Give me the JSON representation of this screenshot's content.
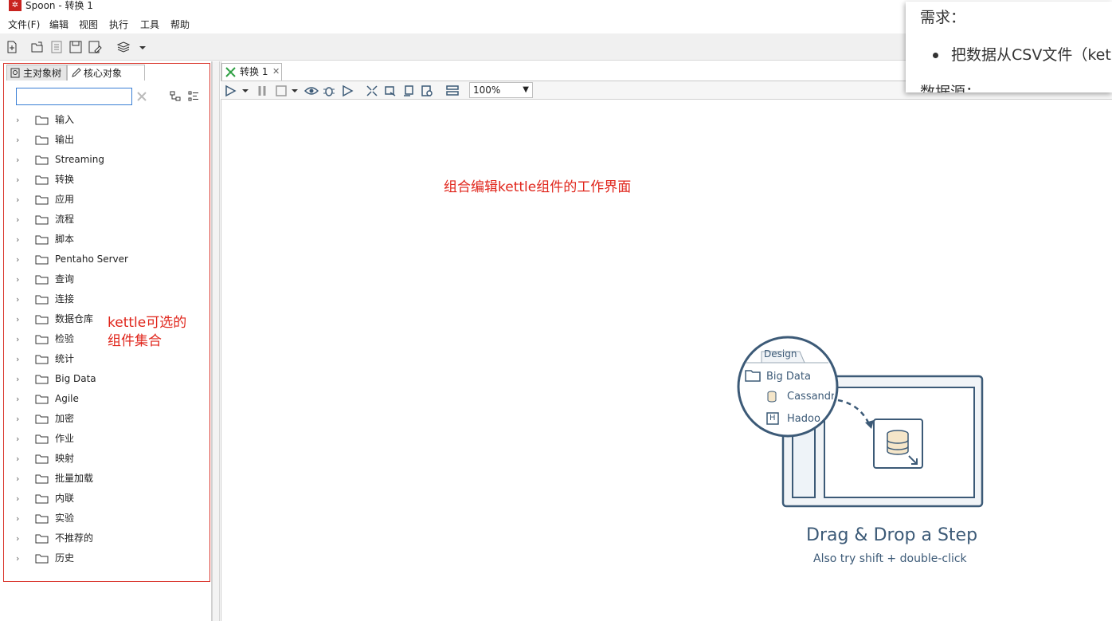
{
  "window": {
    "title": "Spoon - 转换 1"
  },
  "menu": {
    "items": [
      "文件(F)",
      "编辑",
      "视图",
      "执行",
      "工具",
      "帮助"
    ]
  },
  "left_panel": {
    "tabs": [
      "主对象树",
      "核心对象"
    ],
    "search_value": "",
    "tree": [
      "输入",
      "输出",
      "Streaming",
      "转换",
      "应用",
      "流程",
      "脚本",
      "Pentaho Server",
      "查询",
      "连接",
      "数据仓库",
      "检验",
      "统计",
      "Big Data",
      "Agile",
      "加密",
      "作业",
      "映射",
      "批量加载",
      "内联",
      "实验",
      "不推荐的",
      "历史"
    ]
  },
  "annotations": {
    "left_line1": "kettle可选的",
    "left_line2": "组件集合",
    "canvas": "组合编辑kettle组件的工作界面"
  },
  "canvas": {
    "tab_label": "转换 1",
    "zoom": "100%"
  },
  "note_panel": {
    "heading": "需求：",
    "bullet": "把数据从CSV文件（ket",
    "heading2": "数据源："
  },
  "illustration": {
    "design_tab": "Design",
    "folder": "Big Data",
    "item1": "Cassandr",
    "item2": "Hadoo",
    "title": "Drag & Drop a Step",
    "subtitle": "Also try shift + double-click"
  },
  "colors": {
    "annotation": "#e0251b",
    "accent": "#3c5a77",
    "brand": "#c8231f"
  }
}
